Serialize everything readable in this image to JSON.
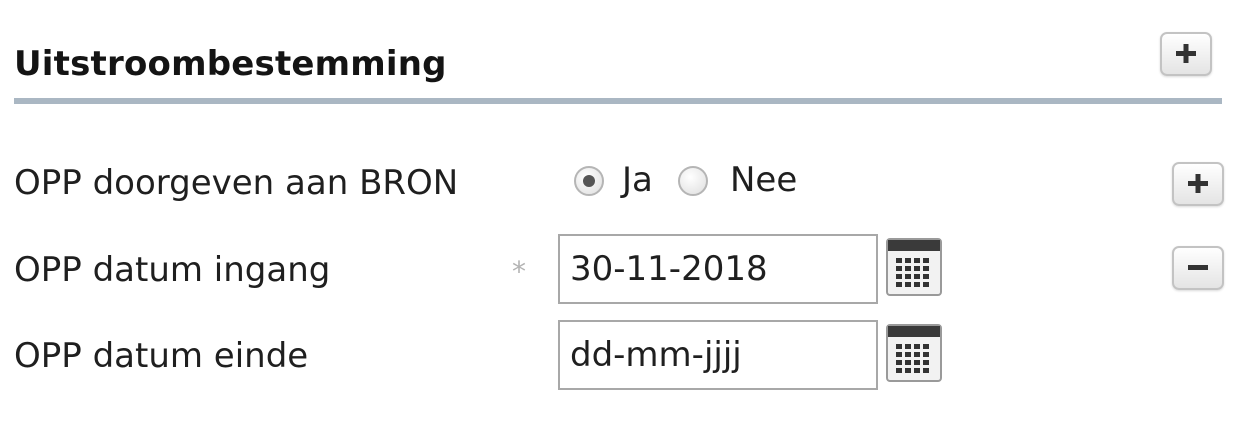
{
  "section": {
    "title": "Uitstroombestemming",
    "add_icon": "plus-icon"
  },
  "fields": {
    "opp_doorgeven": {
      "label": "OPP doorgeven aan BRON",
      "options": [
        {
          "label": "Ja",
          "selected": true
        },
        {
          "label": "Nee",
          "selected": false
        }
      ]
    },
    "opp_datum_ingang": {
      "label": "OPP datum ingang",
      "required_mark": "*",
      "value": "30-11-2018",
      "calendar_icon": "calendar-icon"
    },
    "opp_datum_einde": {
      "label": "OPP datum einde",
      "value": "",
      "placeholder": "dd-mm-jjjj",
      "calendar_icon": "calendar-icon"
    }
  },
  "row_actions": {
    "add_icon": "plus-icon",
    "remove_icon": "minus-icon"
  },
  "colors": {
    "rule": "#aab7c3",
    "text": "#1f1f1f",
    "button_border": "#c3c3c3"
  }
}
